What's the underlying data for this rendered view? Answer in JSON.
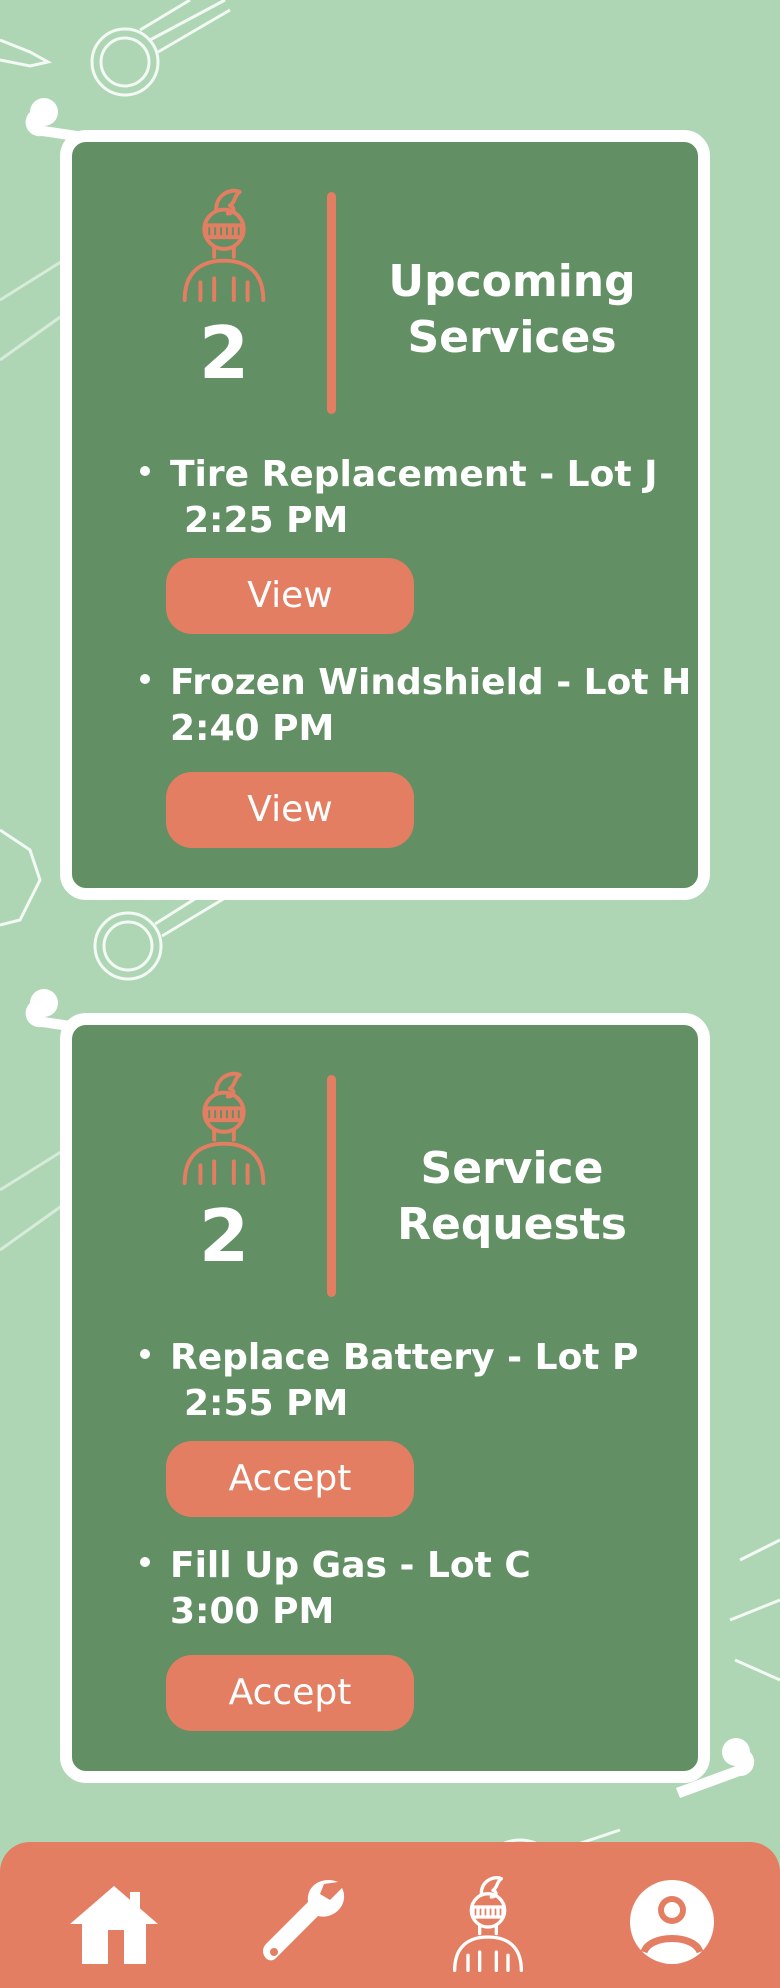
{
  "colors": {
    "background": "#aed6b4",
    "card": "#628f64",
    "card_border": "#ffffff",
    "accent": "#e47e62",
    "text": "#ffffff"
  },
  "upcoming": {
    "icon": "knight-icon",
    "count": "2",
    "title": "Upcoming\nServices",
    "items": [
      {
        "title": "Tire Replacement - Lot J",
        "time": "2:25 PM",
        "button": "View"
      },
      {
        "title": "Frozen Windshield - Lot H",
        "time": "2:40 PM",
        "button": "View"
      }
    ]
  },
  "requests": {
    "icon": "knight-icon",
    "count": "2",
    "title": "Service\nRequests",
    "items": [
      {
        "title": "Replace Battery - Lot P",
        "time": "2:55 PM",
        "button": "Accept"
      },
      {
        "title": "Fill Up Gas - Lot C",
        "time": "3:00 PM",
        "button": "Accept"
      }
    ]
  },
  "nav": {
    "items": [
      {
        "icon": "home-icon"
      },
      {
        "icon": "wrench-icon"
      },
      {
        "icon": "knight-icon"
      },
      {
        "icon": "profile-icon"
      }
    ]
  }
}
